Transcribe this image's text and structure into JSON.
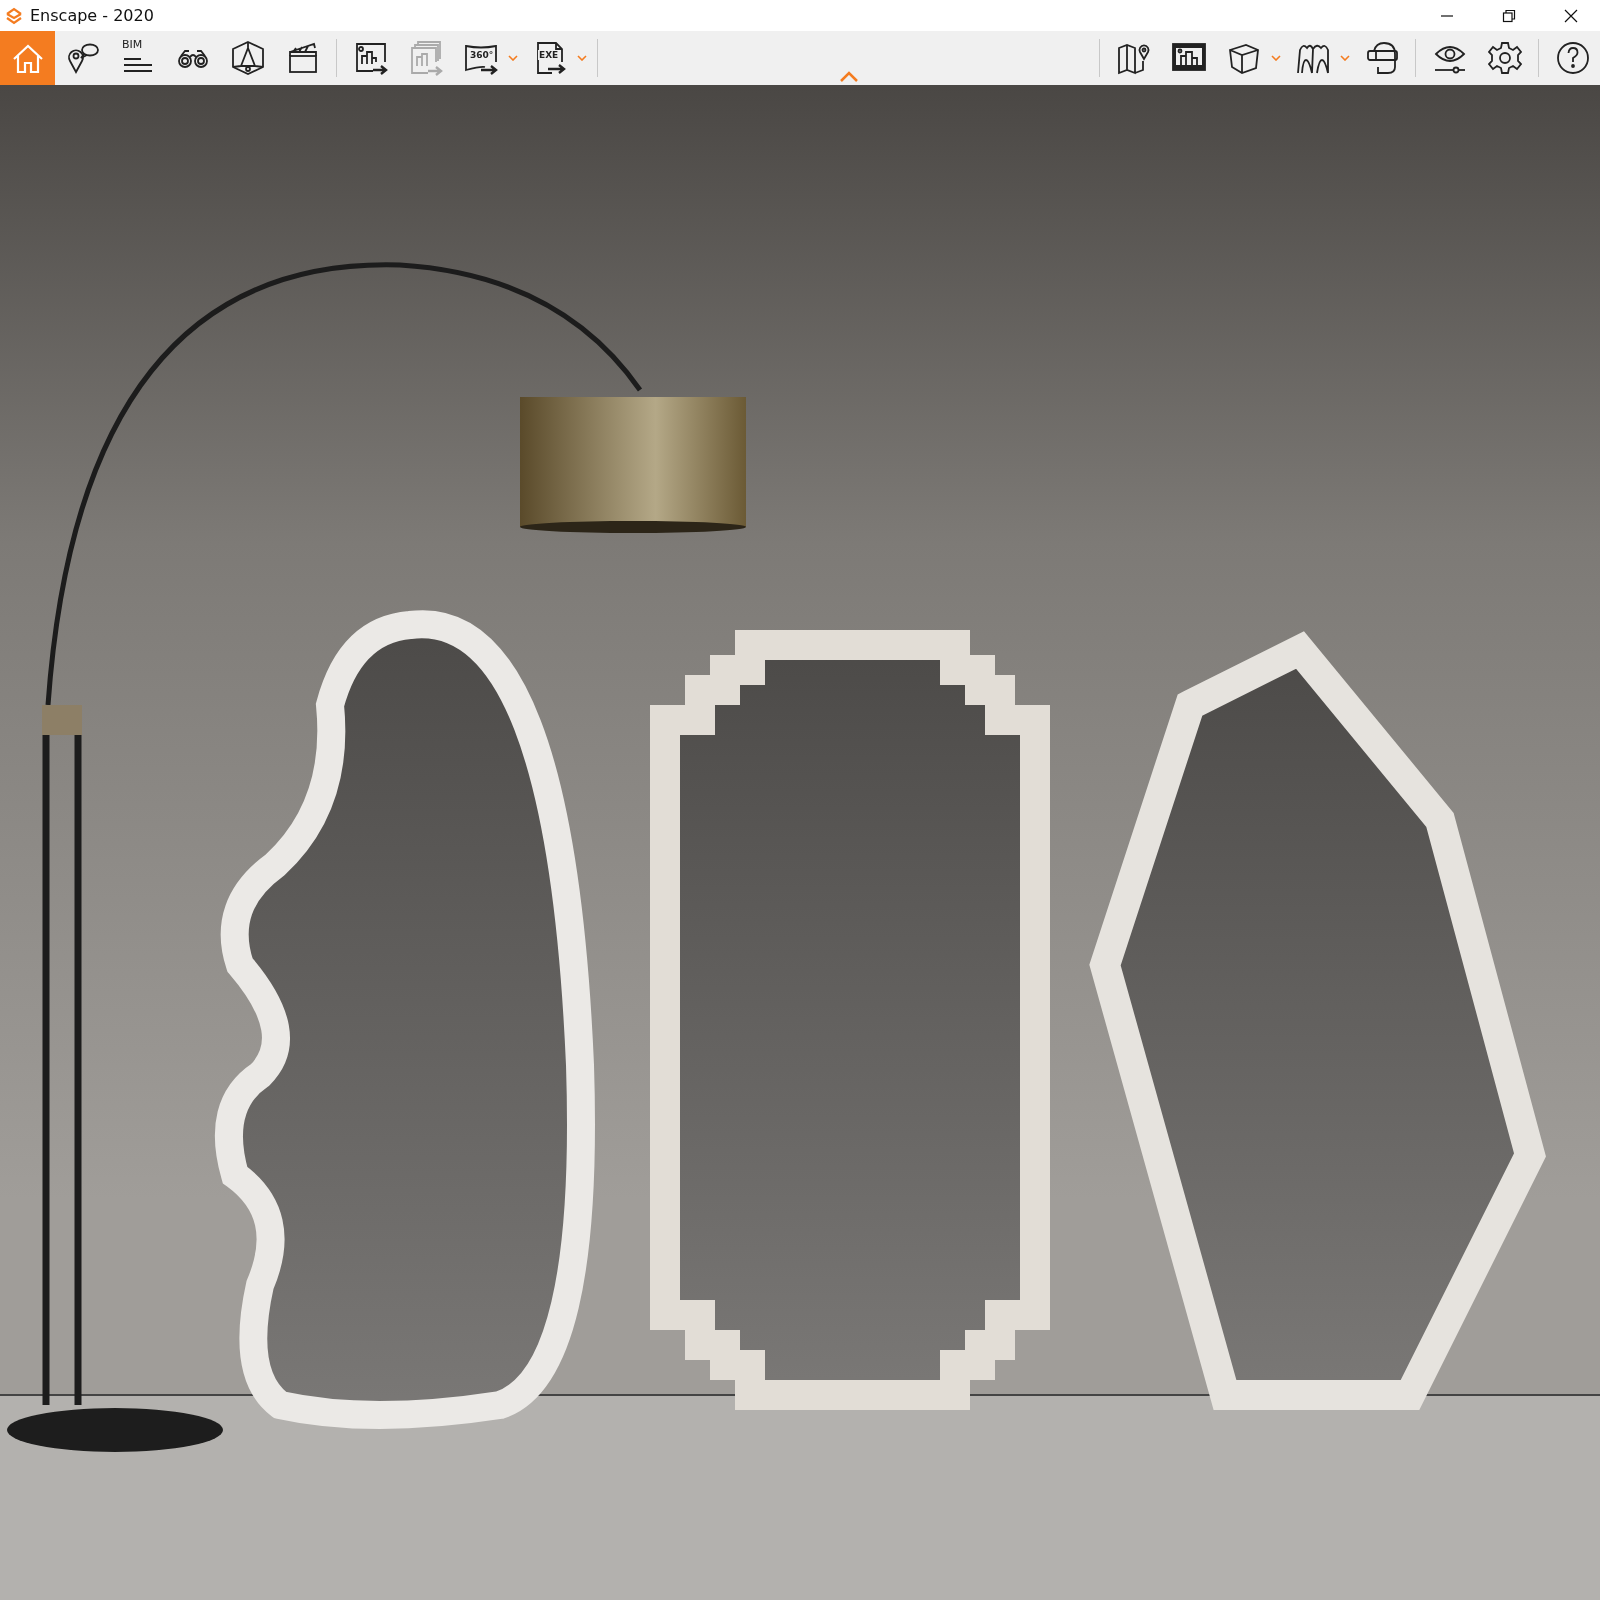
{
  "window": {
    "title": "Enscape - 2020"
  },
  "toolbar": {
    "groups": [
      [
        {
          "kind": "home",
          "selected": true,
          "disabled": false
        },
        {
          "kind": "views",
          "selected": false,
          "disabled": false
        },
        {
          "kind": "bim",
          "label": "BIM",
          "selected": false,
          "disabled": false
        },
        {
          "kind": "binoculars",
          "selected": false,
          "disabled": false
        },
        {
          "kind": "perspective",
          "selected": false,
          "disabled": false
        },
        {
          "kind": "clapper",
          "selected": false,
          "disabled": false
        }
      ],
      [
        {
          "kind": "render",
          "selected": false,
          "disabled": false
        },
        {
          "kind": "batch",
          "selected": false,
          "disabled": true
        },
        {
          "kind": "panorama",
          "label": "360°",
          "selected": false,
          "disabled": false,
          "dropdown": true
        },
        {
          "kind": "exe",
          "label": "EXE",
          "selected": false,
          "disabled": false,
          "dropdown": true
        }
      ]
    ],
    "right_groups": [
      [
        {
          "kind": "map",
          "selected": false,
          "disabled": false
        },
        {
          "kind": "monitor",
          "selected": false,
          "disabled": false
        },
        {
          "kind": "cube",
          "selected": false,
          "disabled": false,
          "dropdown": true
        },
        {
          "kind": "arches",
          "selected": false,
          "disabled": false,
          "dropdown": true
        },
        {
          "kind": "vr",
          "selected": false,
          "disabled": false
        }
      ],
      [
        {
          "kind": "eye",
          "selected": false,
          "disabled": false
        },
        {
          "kind": "gear",
          "selected": false,
          "disabled": false
        }
      ],
      [
        {
          "kind": "help",
          "selected": false,
          "disabled": false
        }
      ]
    ]
  }
}
